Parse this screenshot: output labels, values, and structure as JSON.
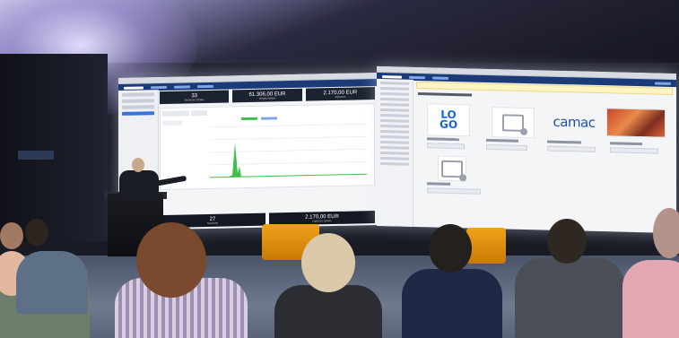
{
  "scene": {
    "left_screen": {
      "kpis": [
        {
          "value": "33",
          "label": "Sesiones totales"
        },
        {
          "value": "61.306,00 EUR",
          "label": "Ventas totales"
        },
        {
          "value": "2.170,00 EUR",
          "label": "Ingresos"
        }
      ],
      "bottom_kpis": [
        {
          "value": "27",
          "label": "Sesiones"
        },
        {
          "value": "2.170,00 EUR",
          "label": "Ingresos totales"
        }
      ]
    },
    "right_screen": {
      "logo_lines": [
        "LO",
        "GO"
      ],
      "brand_text": "camac"
    }
  },
  "colors": {
    "accent": "#1565d8",
    "chart_line": "#3fbf4a",
    "header": "#1b3a78"
  }
}
